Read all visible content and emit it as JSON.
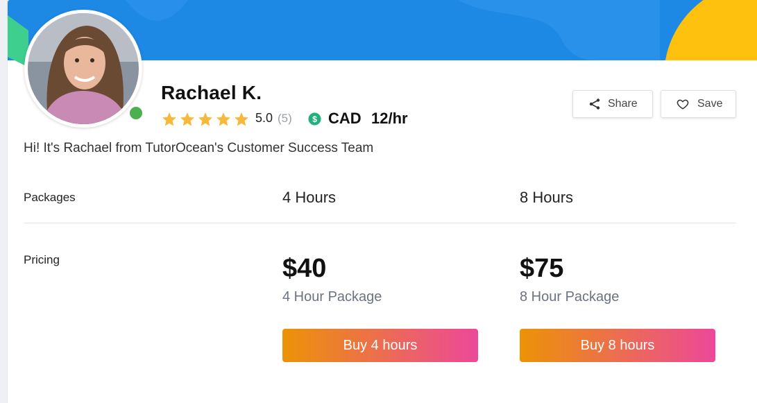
{
  "tutor": {
    "name": "Rachael K.",
    "rating": "5.0",
    "rating_count": "(5)",
    "currency": "CAD",
    "rate": "12/hr",
    "bio": "Hi! It's Rachael from TutorOcean's Customer Success Team",
    "online": true
  },
  "actions": {
    "share_label": "Share",
    "save_label": "Save"
  },
  "packages": {
    "row_label": "Packages",
    "pricing_label": "Pricing",
    "items": [
      {
        "title": "4 Hours",
        "price": "$40",
        "subtitle": "4 Hour Package",
        "button": "Buy 4 hours"
      },
      {
        "title": "8 Hours",
        "price": "$75",
        "subtitle": "8 Hour Package",
        "button": "Buy 8 hours"
      }
    ]
  },
  "colors": {
    "banner": "#1e88e5",
    "accent_yellow": "#fdc10e",
    "online_dot": "#4caf50",
    "star": "#f6b93b",
    "dollar_badge": "#22b07d",
    "buy_gradient_start": "#ec9306",
    "buy_gradient_end": "#ec4899"
  },
  "icons": {
    "share": "share-icon",
    "save": "heart-icon",
    "currency": "dollar-icon",
    "star": "star-icon"
  }
}
